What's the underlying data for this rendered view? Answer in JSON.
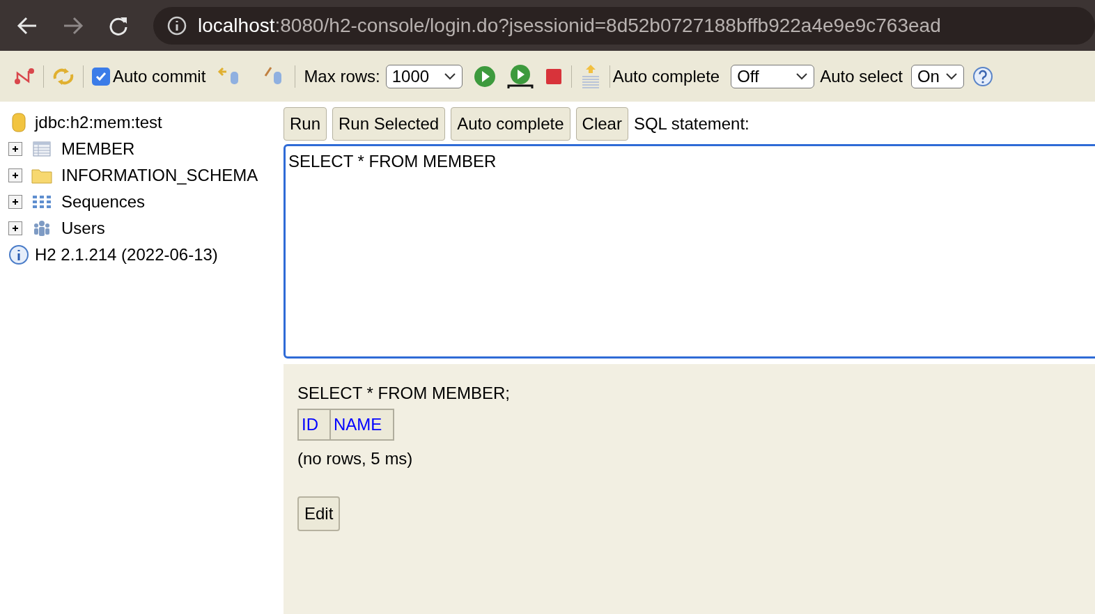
{
  "browser": {
    "url_host": "localhost",
    "url_rest": ":8080/h2-console/login.do?jsessionid=8d52b0727188bffb922a4e9e9c763ead"
  },
  "toolbar": {
    "auto_commit": {
      "label": "Auto commit",
      "checked": true
    },
    "max_rows_label": "Max rows:",
    "max_rows": "1000",
    "auto_complete_label": "Auto complete",
    "auto_complete": "Off",
    "auto_select_label": "Auto select",
    "auto_select": "On"
  },
  "tree": {
    "connection": "jdbc:h2:mem:test",
    "items": [
      {
        "kind": "table",
        "label": "MEMBER",
        "expanded": false
      },
      {
        "kind": "folder",
        "label": "INFORMATION_SCHEMA",
        "expanded": false
      },
      {
        "kind": "sequences",
        "label": "Sequences",
        "expanded": false
      },
      {
        "kind": "users",
        "label": "Users",
        "expanded": false
      }
    ],
    "version": "H2 2.1.214 (2022-06-13)"
  },
  "editor": {
    "buttons": [
      "Run",
      "Run Selected",
      "Auto complete",
      "Clear"
    ],
    "label": "SQL statement:",
    "sql": "SELECT * FROM MEMBER"
  },
  "result": {
    "statement": "SELECT * FROM MEMBER;",
    "columns": [
      "ID",
      "NAME"
    ],
    "summary": "(no rows, 5 ms)",
    "edit_button": "Edit"
  }
}
